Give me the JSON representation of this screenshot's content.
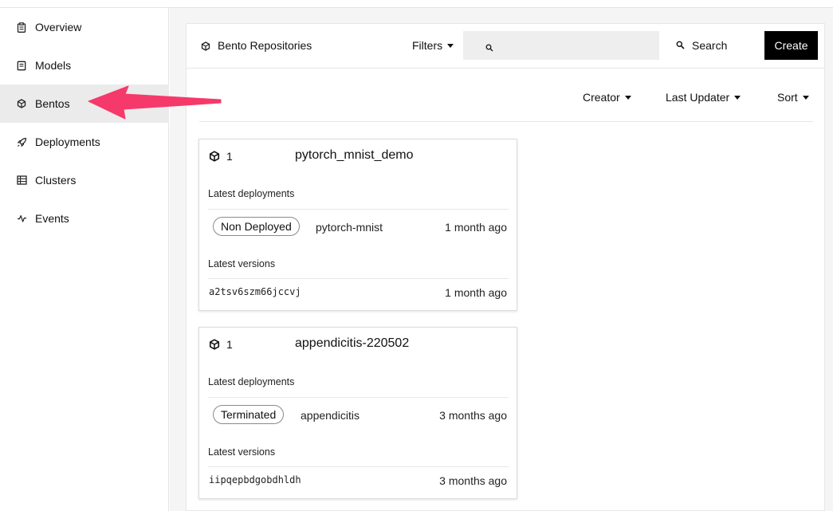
{
  "sidebar": {
    "items": [
      {
        "label": "Overview",
        "icon": "clipboard-icon",
        "active": false
      },
      {
        "label": "Models",
        "icon": "box-icon",
        "active": false
      },
      {
        "label": "Bentos",
        "icon": "cube-icon",
        "active": true
      },
      {
        "label": "Deployments",
        "icon": "rocket-icon",
        "active": false
      },
      {
        "label": "Clusters",
        "icon": "table-icon",
        "active": false
      },
      {
        "label": "Events",
        "icon": "activity-icon",
        "active": false
      }
    ]
  },
  "header": {
    "title": "Bento Repositories",
    "filters_label": "Filters",
    "search_placeholder": "",
    "search_label": "Search",
    "create_label": "Create"
  },
  "sort_bar": {
    "creator_label": "Creator",
    "last_updater_label": "Last Updater",
    "sort_label": "Sort"
  },
  "cards": [
    {
      "count": "1",
      "name": "pytorch_mnist_demo",
      "deployments_label": "Latest deployments",
      "deployment": {
        "status": "Non Deployed",
        "name": "pytorch-mnist",
        "time": "1 month ago"
      },
      "versions_label": "Latest versions",
      "version": {
        "id": "a2tsv6szm66jccvj",
        "time": "1 month ago"
      }
    },
    {
      "count": "1",
      "name": "appendicitis-220502",
      "deployments_label": "Latest deployments",
      "deployment": {
        "status": "Terminated",
        "name": "appendicitis",
        "time": "3 months ago"
      },
      "versions_label": "Latest versions",
      "version": {
        "id": "iipqepbdgobdhldh",
        "time": "3 months ago"
      }
    }
  ],
  "colors": {
    "accent_arrow": "#f5396b",
    "active_nav_bg": "#ebebeb",
    "create_button_bg": "#000000"
  }
}
